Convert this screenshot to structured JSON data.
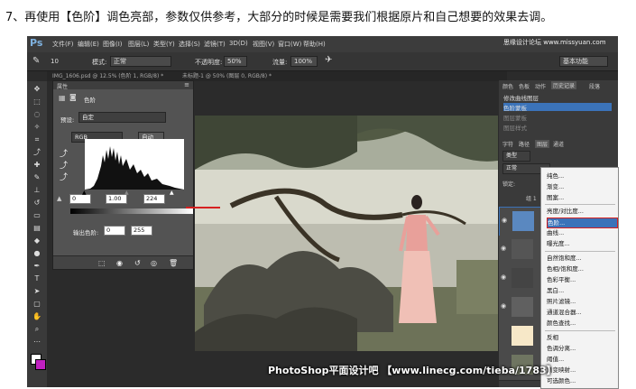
{
  "caption": "7、再使用【色阶】调色亮部，参数仅供参考，大部分的时候是需要我们根据原片和自己想要的效果去调。",
  "app": {
    "logo": "Ps",
    "menu": [
      "文件(F)",
      "编辑(E)",
      "图像(I)",
      "图层(L)",
      "类型(Y)",
      "选择(S)",
      "滤镜(T)",
      "3D(D)",
      "视图(V)",
      "窗口(W)",
      "帮助(H)"
    ],
    "watermark_top": "思缘设计论坛  www.missyuan.com",
    "workspace": "基本功能"
  },
  "options": {
    "brush_size": "10",
    "mode_label": "模式:",
    "mode_value": "正常",
    "opacity_label": "不透明度:",
    "opacity_value": "50%",
    "flow_label": "流量:",
    "flow_value": "100%"
  },
  "doc_tabs": [
    "IMG_1606.psd @ 12.5% (色阶 1, RGB/8) *",
    "未标题-1 @ 50% (图层 0, RGB/8) *"
  ],
  "properties": {
    "header": "属性",
    "title": "色阶",
    "preset_label": "预设:",
    "preset_value": "自定",
    "channel": "RGB",
    "auto_label": "自动",
    "input_black": "0",
    "input_mid": "1.00",
    "input_white": "224",
    "output_label": "输出色阶:",
    "output_black": "0",
    "output_white": "255"
  },
  "right_panel": {
    "top_tabs": [
      "颜色",
      "色板",
      "动作",
      "历史记录",
      "段落"
    ],
    "history": [
      "修改曲线图层",
      "色阶蒙板",
      "图层蒙板",
      "图层样式"
    ],
    "layer_tabs": [
      "字符",
      "路径",
      "图层",
      "通道"
    ],
    "kind": "类型",
    "blend": "正常",
    "lock_label": "锁定:",
    "group_label": "组 1"
  },
  "context_menu": {
    "items": [
      "纯色...",
      "渐变...",
      "图案...",
      "亮度/对比度...",
      "色阶...",
      "曲线...",
      "曝光度...",
      "自然饱和度...",
      "色相/饱和度...",
      "色彩平衡...",
      "黑白...",
      "照片滤镜...",
      "通道混合器...",
      "颜色查找...",
      "反相",
      "色调分离...",
      "阈值...",
      "渐变映射...",
      "可选颜色..."
    ],
    "selected_index": 4
  },
  "bottom_watermark": "PhotoShop平面设计吧 【www.linecg.com/tieba/1783】",
  "colors": {
    "accent_red": "#d62020",
    "selection_blue": "#3b73b9"
  }
}
